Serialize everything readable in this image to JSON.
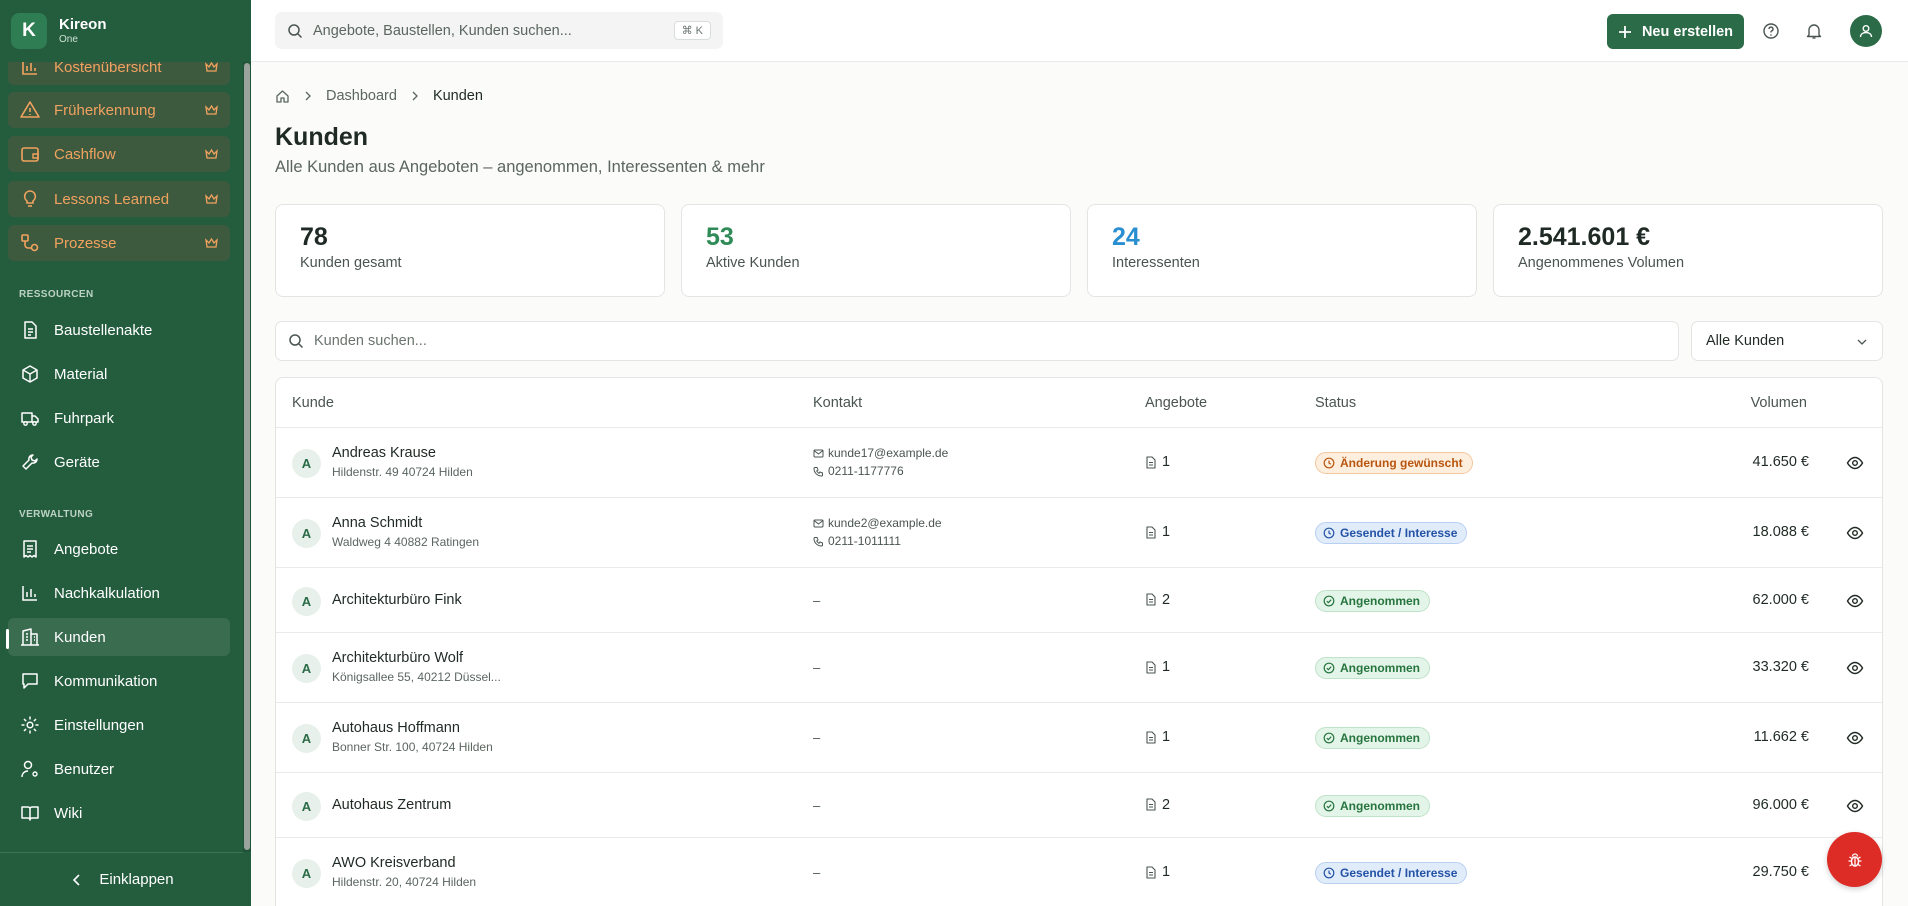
{
  "app": {
    "logo_letter": "K",
    "name": "Kireon",
    "edition": "One"
  },
  "sidebar": {
    "premium_items": [
      {
        "label": "Kostenübersicht",
        "icon": "bar-chart-icon"
      },
      {
        "label": "Früherkennung",
        "icon": "warning-triangle-icon"
      },
      {
        "label": "Cashflow",
        "icon": "wallet-icon"
      },
      {
        "label": "Lessons Learned",
        "icon": "lightbulb-icon"
      },
      {
        "label": "Prozesse",
        "icon": "workflow-icon"
      }
    ],
    "section_resources": "RESSOURCEN",
    "resources": [
      {
        "label": "Baustellenakte",
        "icon": "file-icon"
      },
      {
        "label": "Material",
        "icon": "box-icon"
      },
      {
        "label": "Fuhrpark",
        "icon": "truck-icon"
      },
      {
        "label": "Geräte",
        "icon": "wrench-icon"
      }
    ],
    "section_admin": "VERWALTUNG",
    "admin": [
      {
        "label": "Angebote",
        "icon": "receipt-icon"
      },
      {
        "label": "Nachkalkulation",
        "icon": "bar-chart-icon"
      },
      {
        "label": "Kunden",
        "icon": "building-icon",
        "active": true
      },
      {
        "label": "Kommunikation",
        "icon": "chat-icon"
      },
      {
        "label": "Einstellungen",
        "icon": "gear-icon"
      },
      {
        "label": "Benutzer",
        "icon": "user-gear-icon"
      },
      {
        "label": "Wiki",
        "icon": "book-icon"
      }
    ],
    "collapse_label": "Einklappen"
  },
  "topbar": {
    "search_placeholder": "Angebote, Baustellen, Kunden suchen...",
    "shortcut": "⌘ K",
    "new_button": "Neu erstellen"
  },
  "breadcrumb": {
    "home_icon": "home-icon",
    "items": [
      "Dashboard",
      "Kunden"
    ]
  },
  "page": {
    "title": "Kunden",
    "subtitle": "Alle Kunden aus Angeboten – angenommen, Interessenten & mehr"
  },
  "stats": [
    {
      "value": "78",
      "label": "Kunden gesamt",
      "color": "#1f2a24"
    },
    {
      "value": "53",
      "label": "Aktive Kunden",
      "color": "#2e8b57"
    },
    {
      "value": "24",
      "label": "Interessenten",
      "color": "#2a8fd0"
    },
    {
      "value": "2.541.601 €",
      "label": "Angenommenes Volumen",
      "color": "#1f2a24"
    }
  ],
  "filter": {
    "search_placeholder": "Kunden suchen...",
    "selected": "Alle Kunden"
  },
  "table": {
    "headers": {
      "customer": "Kunde",
      "contact": "Kontakt",
      "offers": "Angebote",
      "status": "Status",
      "volume": "Volumen"
    },
    "rows": [
      {
        "initial": "A",
        "name": "Andreas Krause",
        "address": "Hildenstr. 49 40724 Hilden",
        "email": "kunde17@example.de",
        "phone": "0211-1177776",
        "contact_empty": "",
        "offers": "1",
        "status": "Änderung gewünscht",
        "status_type": "orange",
        "volume": "41.650 €"
      },
      {
        "initial": "A",
        "name": "Anna Schmidt",
        "address": "Waldweg 4 40882 Ratingen",
        "email": "kunde2@example.de",
        "phone": "0211-1011111",
        "contact_empty": "",
        "offers": "1",
        "status": "Gesendet / Interesse",
        "status_type": "blue",
        "volume": "18.088 €"
      },
      {
        "initial": "A",
        "name": "Architekturbüro Fink",
        "address": "",
        "email": "",
        "phone": "",
        "contact_empty": "–",
        "offers": "2",
        "status": "Angenommen",
        "status_type": "green",
        "volume": "62.000 €"
      },
      {
        "initial": "A",
        "name": "Architekturbüro Wolf",
        "address": "Königsallee 55, 40212 Düssel...",
        "email": "",
        "phone": "",
        "contact_empty": "–",
        "offers": "1",
        "status": "Angenommen",
        "status_type": "green",
        "volume": "33.320 €"
      },
      {
        "initial": "A",
        "name": "Autohaus Hoffmann",
        "address": "Bonner Str. 100, 40724 Hilden",
        "email": "",
        "phone": "",
        "contact_empty": "–",
        "offers": "1",
        "status": "Angenommen",
        "status_type": "green",
        "volume": "11.662 €"
      },
      {
        "initial": "A",
        "name": "Autohaus Zentrum",
        "address": "",
        "email": "",
        "phone": "",
        "contact_empty": "–",
        "offers": "2",
        "status": "Angenommen",
        "status_type": "green",
        "volume": "96.000 €"
      },
      {
        "initial": "A",
        "name": "AWO Kreisverband",
        "address": "Hildenstr. 20, 40724 Hilden",
        "email": "",
        "phone": "",
        "contact_empty": "–",
        "offers": "1",
        "status": "Gesendet / Interesse",
        "status_type": "blue",
        "volume": "29.750 €"
      }
    ]
  },
  "colors": {
    "brand": "#245c3e",
    "accent": "#2b6b47",
    "premium": "#f2a25f",
    "fab": "#dd2b25"
  }
}
